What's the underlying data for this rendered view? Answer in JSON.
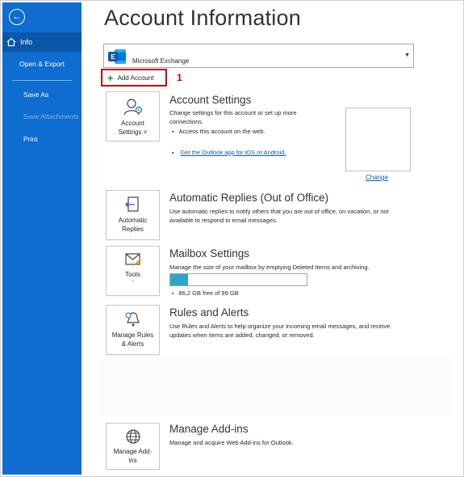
{
  "sidebar": {
    "back_icon": "back-arrow-icon",
    "items": [
      {
        "label": "Info",
        "icon": "home-icon",
        "selected": true
      },
      {
        "label": "Open & Export"
      },
      {
        "label": "Save As"
      },
      {
        "label": "Save Attachments",
        "disabled": true
      },
      {
        "label": "Print"
      }
    ]
  },
  "page": {
    "title": "Account Information"
  },
  "account": {
    "name": "Microsoft Exchange",
    "icon": "exchange-logo-icon"
  },
  "add_account": {
    "label": "Add Account",
    "step_number": "1"
  },
  "sections": {
    "account_settings": {
      "tile_label": "Account Settings ˅",
      "title": "Account Settings",
      "desc": "Change settings for this account or set up more connections.",
      "bullet1": "Access this account on the web.",
      "link": "Get the Outlook app for iOS or Android.",
      "change": "Change"
    },
    "auto_replies": {
      "tile_label": "Automatic Replies",
      "title": "Automatic Replies (Out of Office)",
      "desc": "Use automatic replies to notify others that you are out of office, on vacation, or not available to respond to email messages."
    },
    "mailbox": {
      "tile_label": "Tools",
      "title": "Mailbox Settings",
      "desc": "Manage the size of your mailbox by emptying Deleted Items and archiving.",
      "storage": "86,2 GB free of 99 GB",
      "used_fraction": 0.13
    },
    "rules": {
      "tile_label": "Manage Rules & Alerts",
      "title": "Rules and Alerts",
      "desc": "Use Rules and Alerts to help organize your incoming email messages, and receive updates when items are added, changed, or removed."
    },
    "addins": {
      "tile_label": "Manage Add-ins",
      "title": "Manage Add-ins",
      "desc": "Manage and acquire Web Add-ins for Outlook."
    }
  },
  "colors": {
    "sidebar": "#0f6cd0",
    "sidebar_selected": "#0a56aa",
    "highlight": "#c00000",
    "link": "#0b5cad",
    "progress": "#2ea6c8"
  }
}
